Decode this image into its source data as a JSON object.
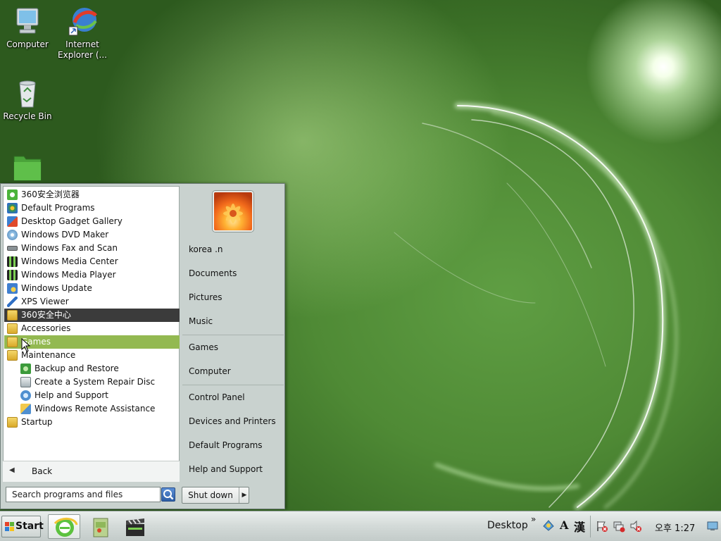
{
  "desktop": {
    "icons": [
      {
        "label": "Computer"
      },
      {
        "label": "Internet Explorer (..."
      },
      {
        "label": "Recycle Bin"
      },
      {
        "label": ""
      }
    ]
  },
  "start_menu": {
    "programs": [
      {
        "label": "360安全浏览器",
        "icon": "browser-360-icon"
      },
      {
        "label": "Default Programs",
        "icon": "default-programs-icon"
      },
      {
        "label": "Desktop Gadget Gallery",
        "icon": "gadget-gallery-icon"
      },
      {
        "label": "Windows DVD Maker",
        "icon": "dvd-maker-icon"
      },
      {
        "label": "Windows Fax and Scan",
        "icon": "fax-scan-icon"
      },
      {
        "label": "Windows Media Center",
        "icon": "media-center-icon"
      },
      {
        "label": "Windows Media Player",
        "icon": "media-player-icon"
      },
      {
        "label": "Windows Update",
        "icon": "windows-update-icon"
      },
      {
        "label": "XPS Viewer",
        "icon": "xps-viewer-icon"
      },
      {
        "label": "360安全中心",
        "icon": "folder-icon",
        "state": "selected"
      },
      {
        "label": "Accessories",
        "icon": "folder-icon"
      },
      {
        "label": "Games",
        "icon": "folder-icon",
        "state": "hover"
      },
      {
        "label": "Maintenance",
        "icon": "folder-icon"
      },
      {
        "label": "Backup and Restore",
        "icon": "backup-restore-icon",
        "indent": true
      },
      {
        "label": "Create a System Repair Disc",
        "icon": "repair-disc-icon",
        "indent": true
      },
      {
        "label": "Help and Support",
        "icon": "help-support-icon",
        "indent": true
      },
      {
        "label": "Windows Remote Assistance",
        "icon": "remote-assistance-icon",
        "indent": true
      },
      {
        "label": "Startup",
        "icon": "folder-icon"
      }
    ],
    "back_label": "Back",
    "search_placeholder": "Search programs and files",
    "right_items": [
      {
        "label": "korea .n"
      },
      {
        "label": "Documents"
      },
      {
        "label": "Pictures"
      },
      {
        "label": "Music"
      },
      {
        "label": "Games"
      },
      {
        "label": "Computer"
      },
      {
        "label": "Control Panel"
      },
      {
        "label": "Devices and Printers"
      },
      {
        "label": "Default Programs"
      },
      {
        "label": "Help and Support"
      }
    ],
    "shutdown_label": "Shut down"
  },
  "taskbar": {
    "start_label": "Start",
    "toolbar_label": "Desktop",
    "toolbar_chevron": "»",
    "ime_mode": "A",
    "ime_hanja": "漢",
    "clock": "오후 1:27"
  },
  "colors": {
    "selected_bg": "#3b3b3b",
    "hover_bg": "#93b951",
    "wallpaper_green": "#4f8a35"
  }
}
